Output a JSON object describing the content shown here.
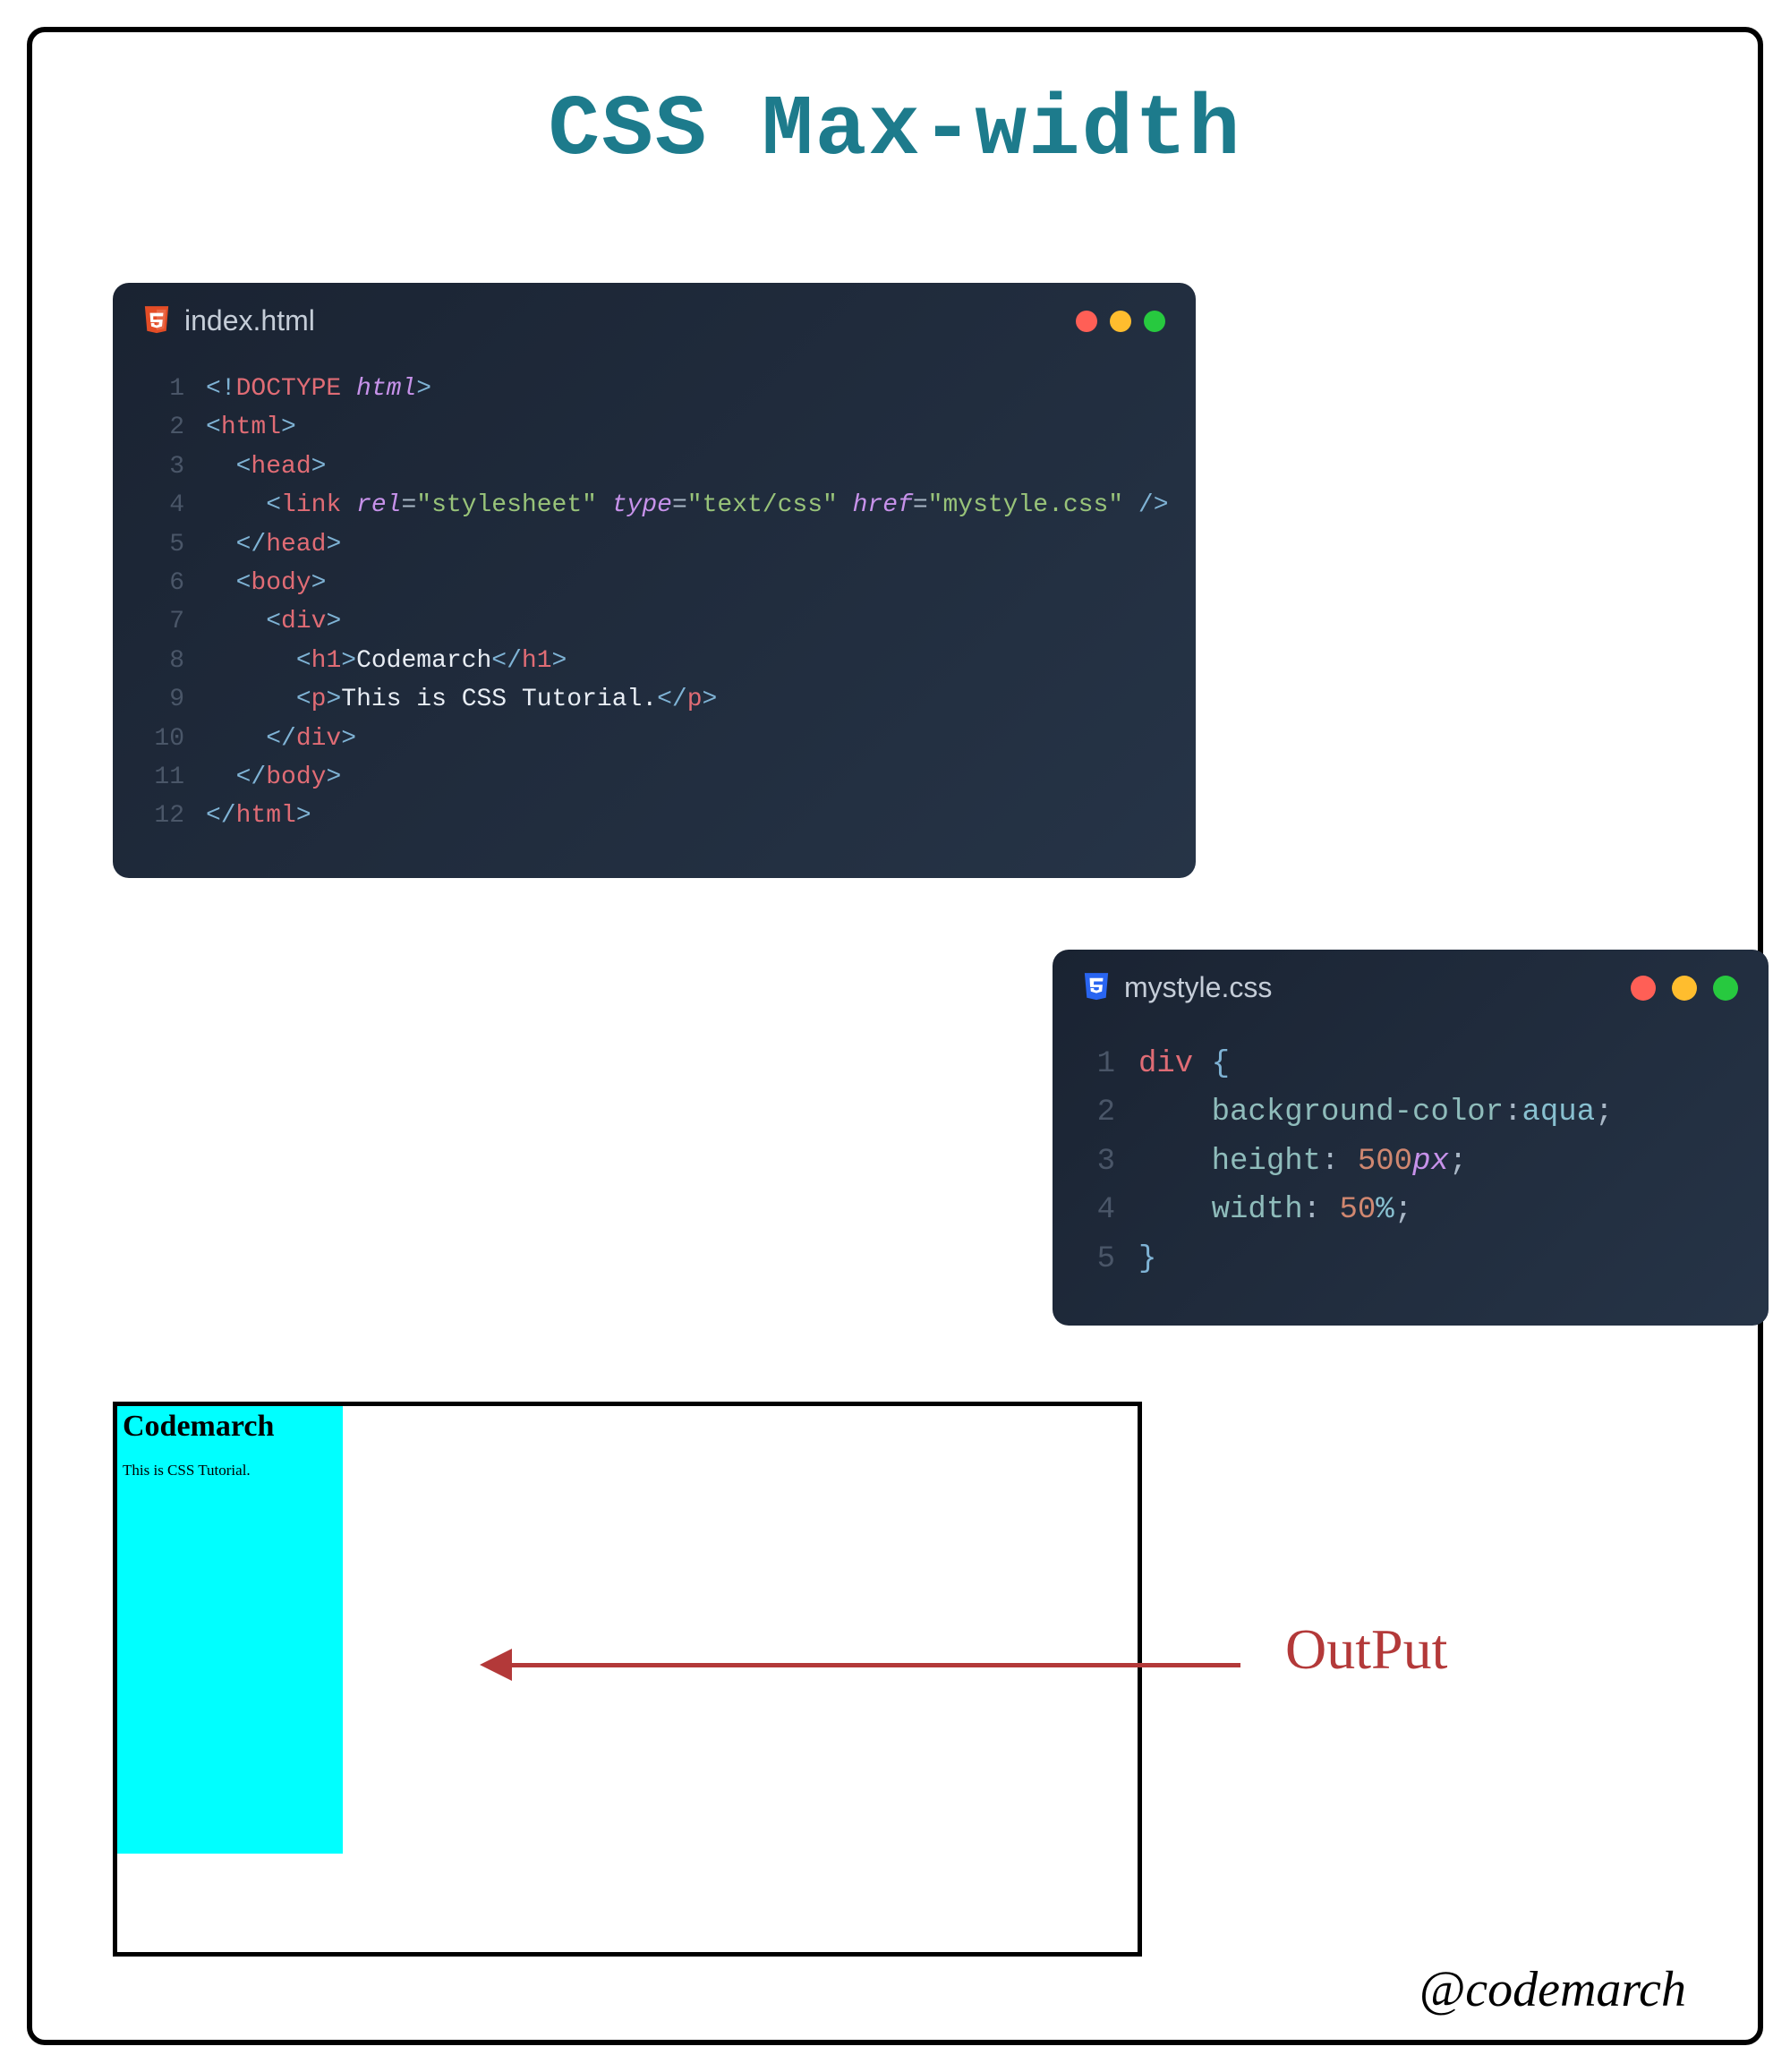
{
  "title": "CSS Max-width",
  "htmlWindow": {
    "filename": "index.html",
    "lines": {
      "l1": {
        "num": "1"
      },
      "l2": {
        "num": "2"
      },
      "l3": {
        "num": "3"
      },
      "l4": {
        "num": "4",
        "rel": "rel",
        "relVal": "\"stylesheet\"",
        "type": "type",
        "typeVal": "\"text/css\"",
        "href": "href",
        "hrefVal": "\"mystyle.css\""
      },
      "l5": {
        "num": "5"
      },
      "l6": {
        "num": "6"
      },
      "l7": {
        "num": "7"
      },
      "l8": {
        "num": "8",
        "text": "Codemarch"
      },
      "l9": {
        "num": "9",
        "text": "This is CSS Tutorial."
      },
      "l10": {
        "num": "10"
      },
      "l11": {
        "num": "11"
      },
      "l12": {
        "num": "12"
      }
    },
    "tags": {
      "doctype": "DOCTYPE",
      "htmlAttr": "html",
      "html": "html",
      "head": "head",
      "link": "link",
      "body": "body",
      "div": "div",
      "h1": "h1",
      "p": "p"
    }
  },
  "cssWindow": {
    "filename": "mystyle.css",
    "lines": {
      "l1": {
        "num": "1",
        "selector": "div",
        "brace": "{"
      },
      "l2": {
        "num": "2",
        "prop": "background-color",
        "colon": ":",
        "value": "aqua",
        "semi": ";"
      },
      "l3": {
        "num": "3",
        "prop": "height",
        "colon": ": ",
        "number": "500",
        "unit": "px",
        "semi": ";"
      },
      "l4": {
        "num": "4",
        "prop": "width",
        "colon": ": ",
        "number": "50",
        "unit": "%",
        "semi": ";"
      },
      "l5": {
        "num": "5",
        "brace": "}"
      }
    }
  },
  "output": {
    "heading": "Codemarch",
    "paragraph": "This is CSS Tutorial."
  },
  "outputLabel": "OutPut",
  "handle": "@codemarch",
  "brackets": {
    "lt": "<",
    "gt": ">",
    "ltExcl": "<!",
    "ltSlash": "</",
    "spSlashGt": " />",
    "eq": "="
  }
}
